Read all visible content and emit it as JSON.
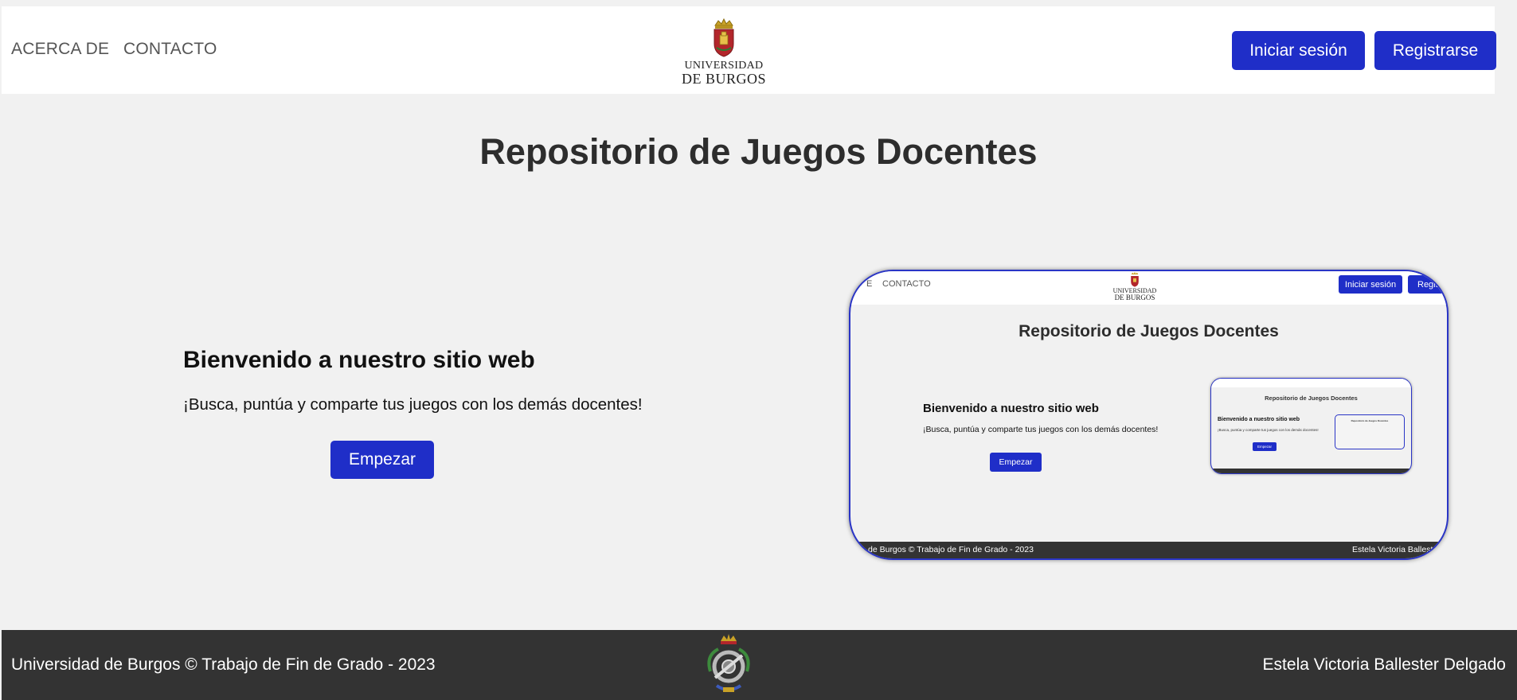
{
  "header": {
    "nav": [
      "ACERCA DE",
      "CONTACTO"
    ],
    "logo": {
      "line1": "UNIVERSIDAD",
      "line2": "DE BURGOS"
    },
    "login_label": "Iniciar sesión",
    "register_label": "Registrarse"
  },
  "main": {
    "title": "Repositorio de Juegos Docentes",
    "welcome_title": "Bienvenido a nuestro sitio web",
    "welcome_subtitle": "¡Busca, puntúa y comparte tus juegos con los demás docentes!",
    "start_label": "Empezar"
  },
  "preview": {
    "nav_partial": "E",
    "nav_contact": "CONTACTO",
    "logo": {
      "line1": "UNIVERSIDAD",
      "line2": "DE BURGOS"
    },
    "login_label": "Iniciar sesión",
    "register_partial": "Regis",
    "title": "Repositorio de Juegos Docentes",
    "welcome_title": "Bienvenido a nuestro sitio web",
    "welcome_subtitle": "¡Busca, puntúa y comparte tus juegos con los demás docentes!",
    "start_label": "Empezar",
    "footer_left": "de Burgos © Trabajo de Fin de Grado - 2023",
    "footer_right": "Estela Victoria Ballest",
    "nested": {
      "title": "Repositorio de Juegos Docentes",
      "welcome_title": "Bienvenido a nuestro sitio web",
      "welcome_subtitle": "¡Busca, puntúa y comparte tus juegos con los demás docentes!",
      "start_label": "Empezar"
    }
  },
  "footer": {
    "left": "Universidad de Burgos © Trabajo de Fin de Grado - 2023",
    "right": "Estela Victoria Ballester Delgado"
  },
  "colors": {
    "accent": "#1f2ec8",
    "background": "#f1f1f1",
    "footer_bg": "#333333"
  },
  "icons": {
    "logo": "university-crest-icon",
    "footer": "faculty-emblem-icon"
  }
}
